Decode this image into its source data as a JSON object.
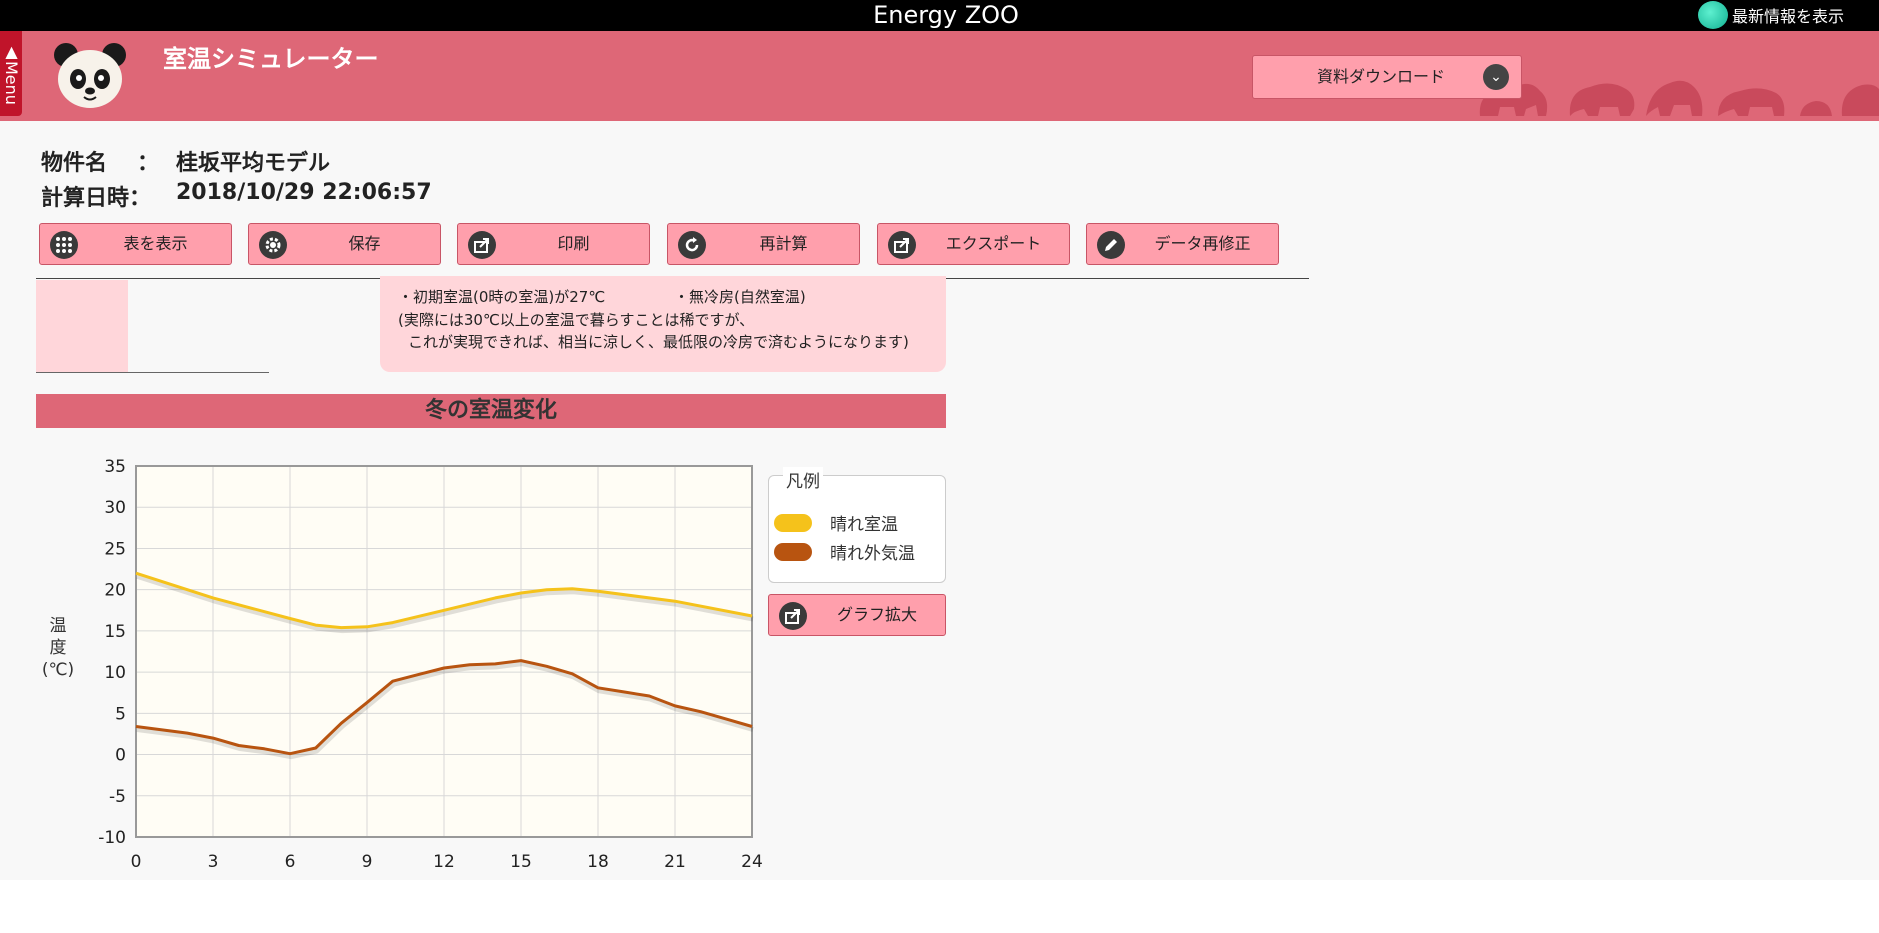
{
  "app": {
    "title": "Energy ZOO",
    "news_label": "最新情報を表示",
    "menu_label": "▲Menu"
  },
  "header": {
    "title": "室温シミュレーター",
    "download_label": "資料ダウンロード"
  },
  "property": {
    "name_label": "物件名",
    "name_colon": "：",
    "name_value": "桂坂平均モデル",
    "date_label": "計算日時：",
    "date_value": "2018/10/29 22:06:57"
  },
  "toolbar": [
    {
      "label": "表を表示",
      "icon": "grid-icon"
    },
    {
      "label": "保存",
      "icon": "gear-icon"
    },
    {
      "label": "印刷",
      "icon": "share-icon"
    },
    {
      "label": "再計算",
      "icon": "refresh-icon"
    },
    {
      "label": "エクスポート",
      "icon": "export-icon"
    },
    {
      "label": "データ再修正",
      "icon": "pencil-icon"
    }
  ],
  "note": {
    "line1a": "・初期室温(0時の室温)が27℃",
    "line1b": "・無冷房(自然室温)",
    "line2": "(実際には30℃以上の室温で暮らすことは稀ですが、",
    "line3": "これが実現できれば、相当に涼しく、最低限の冷房で済むようになります)"
  },
  "section": {
    "title": "冬の室温変化"
  },
  "legend": {
    "title": "凡例",
    "items": [
      {
        "label": "晴れ室温",
        "color": "#f5c21b"
      },
      {
        "label": "晴れ外気温",
        "color": "#b85410"
      }
    ]
  },
  "zoom_button": {
    "label": "グラフ拡大",
    "icon": "export-icon"
  },
  "chart_data": {
    "type": "line",
    "ylabel": "温度(℃)",
    "xlim": [
      0,
      24
    ],
    "ylim": [
      -10,
      35
    ],
    "xticks": [
      0,
      3,
      6,
      9,
      12,
      15,
      18,
      21,
      24
    ],
    "yticks": [
      -10,
      -5,
      0,
      5,
      10,
      15,
      20,
      25,
      30,
      35
    ],
    "grid": true,
    "legend_position": "right",
    "series": [
      {
        "name": "晴れ室温",
        "color": "#f5c21b",
        "x": [
          0,
          3,
          6,
          7,
          8,
          9,
          10,
          12,
          14,
          15,
          16,
          17,
          18,
          21,
          24
        ],
        "y": [
          22,
          19,
          16.5,
          15.7,
          15.4,
          15.5,
          16,
          17.5,
          19,
          19.6,
          20,
          20.1,
          19.8,
          18.6,
          16.8
        ]
      },
      {
        "name": "晴れ外気温",
        "color": "#b85410",
        "x": [
          0,
          2,
          3,
          4,
          5,
          6,
          7,
          8,
          9,
          10,
          11,
          12,
          13,
          14,
          15,
          16,
          17,
          18,
          19,
          20,
          21,
          22,
          23,
          24
        ],
        "y": [
          3.4,
          2.6,
          2,
          1.1,
          0.7,
          0.1,
          0.8,
          3.8,
          6.3,
          8.9,
          9.7,
          10.5,
          10.9,
          11,
          11.4,
          10.7,
          9.8,
          8.1,
          7.6,
          7.1,
          5.9,
          5.2,
          4.3,
          3.4
        ]
      }
    ]
  }
}
